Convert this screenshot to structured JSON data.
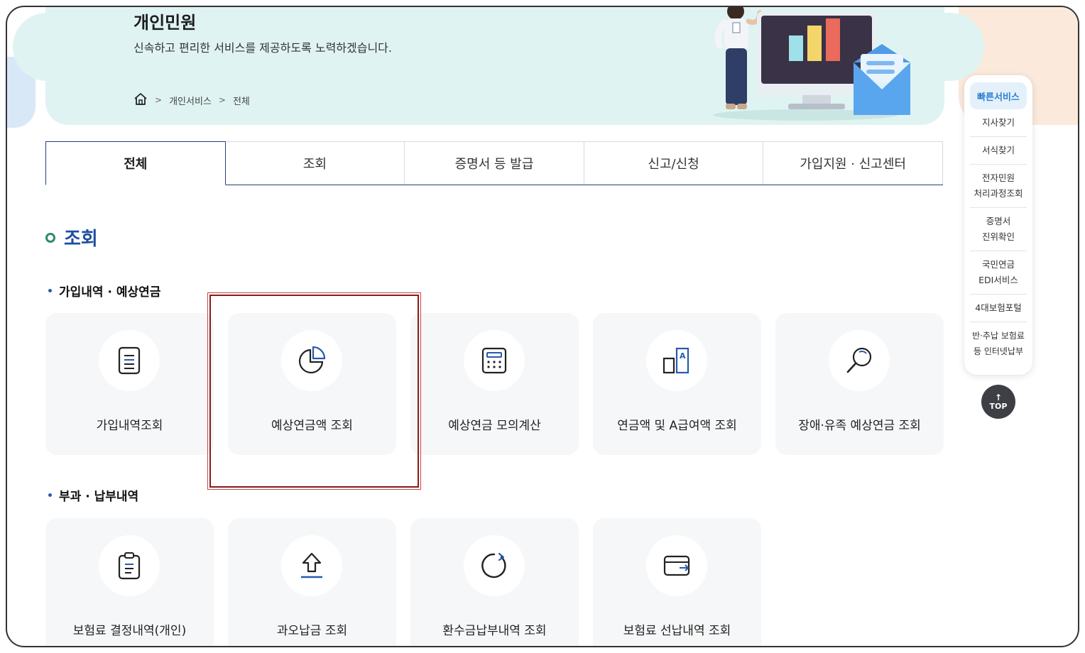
{
  "header": {
    "title": "개인민원",
    "subtitle": "신속하고 편리한 서비스를 제공하도록 노력하겠습니다."
  },
  "breadcrumb": {
    "home_icon": "home-icon",
    "items": [
      "개인서비스",
      "전체"
    ],
    "separator": ">"
  },
  "tabs": [
    {
      "label": "전체",
      "active": true
    },
    {
      "label": "조회",
      "active": false
    },
    {
      "label": "증명서 등 발급",
      "active": false
    },
    {
      "label": "신고/신청",
      "active": false
    },
    {
      "label": "가입지원 · 신고센터",
      "active": false
    }
  ],
  "section": {
    "title": "조회"
  },
  "groups": [
    {
      "heading": "가입내역 · 예상연금",
      "cards": [
        {
          "label": "가입내역조회",
          "icon": "document-list-icon"
        },
        {
          "label": "예상연금액 조회",
          "icon": "pie-chart-icon",
          "highlighted": true
        },
        {
          "label": "예상연금 모의계산",
          "icon": "calculator-icon"
        },
        {
          "label": "연금액 및 A급여액 조회",
          "icon": "a-benefit-icon"
        },
        {
          "label": "장애·유족 예상연금 조회",
          "icon": "magnifier-icon"
        }
      ]
    },
    {
      "heading": "부과 · 납부내역",
      "cards": [
        {
          "label": "보험료 결정내역(개인)",
          "icon": "clipboard-icon"
        },
        {
          "label": "과오납금 조회",
          "icon": "upload-arrow-icon"
        },
        {
          "label": "환수금납부내역 조회",
          "icon": "refresh-icon"
        },
        {
          "label": "보험료 선납내역 조회",
          "icon": "wallet-icon"
        }
      ]
    }
  ],
  "quick_menu": {
    "title": "빠른서비스",
    "items": [
      "지사찾기",
      "서식찾기",
      "전자민원\n처리과정조회",
      "증명서\n진위확인",
      "국민연금\nEDI서비스",
      "4대보험포털",
      "반·추납 보험료\n등 인터넷납부"
    ]
  },
  "top_button": {
    "label": "TOP",
    "arrow": "↑"
  },
  "colors": {
    "banner_bg": "#dff4f2",
    "accent_blue": "#1d4ea0",
    "tab_border": "#24407a",
    "card_bg": "#f6f7f8",
    "highlight_border": "#8b1a1a"
  }
}
